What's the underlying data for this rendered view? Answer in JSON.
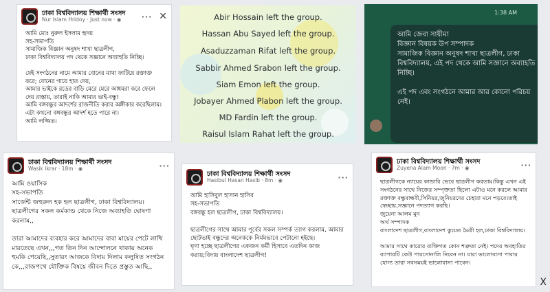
{
  "card1": {
    "page_name": "ঢাকা বিশ্ববিদ্যালয় শিক্ষার্থী সংসদ",
    "author": "Nur Islam Hridoy",
    "time": "Just now",
    "more": "···",
    "close": "✕",
    "text": "আমি মোঃ নুরুল ইসলাম হৃদয়\nসহ-সভাপতি\nসামাজিক বিজ্ঞান অনুষদ শাখা ছাত্রলীগ,\nঢাকা বিশ্ববিদ্যালয় পদ থেকে সজ্ঞানে অব্যাহতি নিচ্ছি।\n\nযেই সংগঠনের নামে আমার বোনের মাথা ফাটিয়ে রক্তাক্ত করে; বোনের গায়ে হাত দেয়,\nআমার ভাইকে রডের বাড়ি মেরে মেরে আধমরা করে ফেলে দেয় রাস্তায়, তারাই নাকি আমার ভাই-বন্ধু!\nআমি বঙ্গবন্ধুর আদর্শের রাজনীতি করার অঙ্গীকার করেছিলাম।\nএটা কখনো বঙ্গবন্ধুর আদর্শ হতে পারে না।\nআমি লজ্জিত।"
  },
  "card2": {
    "lines": [
      "Abir Hossain left the group.",
      "Hassan Abu Sayed left the group.",
      "Asaduzzaman Rifat left the group.",
      "Sabbir Ahmed Srabon left the group.",
      "Siam Emon left the group.",
      "Jobayer Ahmed Plabon left the group.",
      "MD Fardin left the group.",
      "Raisul Islam Rahat left the group."
    ]
  },
  "card3": {
    "time": "1:38 AM",
    "text": "আমি জেবা সায়ীমা\nবিজ্ঞান বিষয়ক উপ সম্পাদক\nসামাজিক বিজ্ঞান অনুষদ শাখা ছাত্রলীগ, ঢাকা বিশ্ববিদ্যালয়, এই পদ থেকে আমি সজ্ঞানে অব্যাহতি নিচ্ছি।\n\nএই পদ এবং সংগঠনে আমার আর কোনো পরিচয় নেই।"
  },
  "card4": {
    "page_name": "ঢাকা বিশ্ববিদ্যালয় শিক্ষার্থী সংসদ",
    "author": "Wasik Ikrar",
    "time": "18m",
    "more": "···",
    "text": "আমি ওয়াসিক\nসহ-সভাপতি\nসার্জেন্ট জহুরুল হক হল ছাত্রলীগ, ঢাকা বিশ্ববিদ্যালয়।\nছাত্রলীগের সকল কর্মকাণ্ড থেকে নিজে অব্যাহতি ঘোষণা করলাম,,\n\nতারা আমাদের ব্যবহার করে আমাদের বাবা মায়ের পেটে লাথি মারতেছে এখন,,,গত তিন দিন আন্দোলনে থাকায় অনেক হুমকি পেয়েছি,,সুতারং আজকে বিদায় দিলাম কলুষিত সংগঠন কে,,,রাজপথে যৌক্তিক বিষয়ে জীবন দিতে প্রস্তুত আছি,,"
  },
  "card5": {
    "page_name": "ঢাকা বিশ্ববিদ্যালয় শিক্ষার্থী সংসদ",
    "author": "Hasibul Hasan Hasib",
    "time": "8m",
    "more": "···",
    "text": "আমি হাসিবুল হাসান হাসিব\nসহ-সভাপতি\nবঙ্গবন্ধু হল ছাত্রলীগ, ঢাকা বিশ্ববিদ্যালয়।\n\nছাত্রলীগের সাথে আমার পূর্বের সকল সম্পর্ক ত্যাগ করলাম, আমার ছোটভাই বন্ধুদের অনেককে নির্মমভাবে পেটানো হইছে।\nঘৃণা হচ্ছে ছাত্রলীগের একজন কর্মী হিসাবে এতদিন কাজ করায়;বিদায় বাংলাদেশ ছাত্রলীগ!"
  },
  "card6": {
    "page_name": "ঢাকা বিশ্ববিদ্যালয় শিক্ষার্থী সংসদ",
    "author": "Zuyena Alam Moon",
    "time": "7m",
    "more": "···",
    "text": "ছাত্রলীগকে ন্যায়ের কান্ডারি ভেবে ছাত্রলীগ করতাম।কিন্তু এখন এই সংগঠনের সাথে নিজের সম্পৃক্ততা ছিলো এটাও মনে করলে আমার রক্তাক্ত বন্ধুবান্ধবী,সিনিয়র,জুনিয়রদের চেহারা মনে পড়বে।তাই স্বেচ্ছায়,সজ্ঞানে পদত্যাগ করছি।\nজুয়েনা আলম মুন\nঅর্থ সম্পাদক\nবাংলাদেশ ছাত্রলীগ,বাংলাদেশ কুয়েত মৈত্রী হল,ঢাকা বিশ্ববিদ্যালয়।\n\nআমার সাথে কারোর ব্যক্তিগত কোন শত্রুতা নেই। পদের অবহাতির ব্যাপারটি কেউ পারসোনালি নিবেন না। যারা ভালোবাসা পাবার যোগ্য তারা সবসময়ই ভালোবাসা পাবেন।"
  },
  "corner_close": "X"
}
